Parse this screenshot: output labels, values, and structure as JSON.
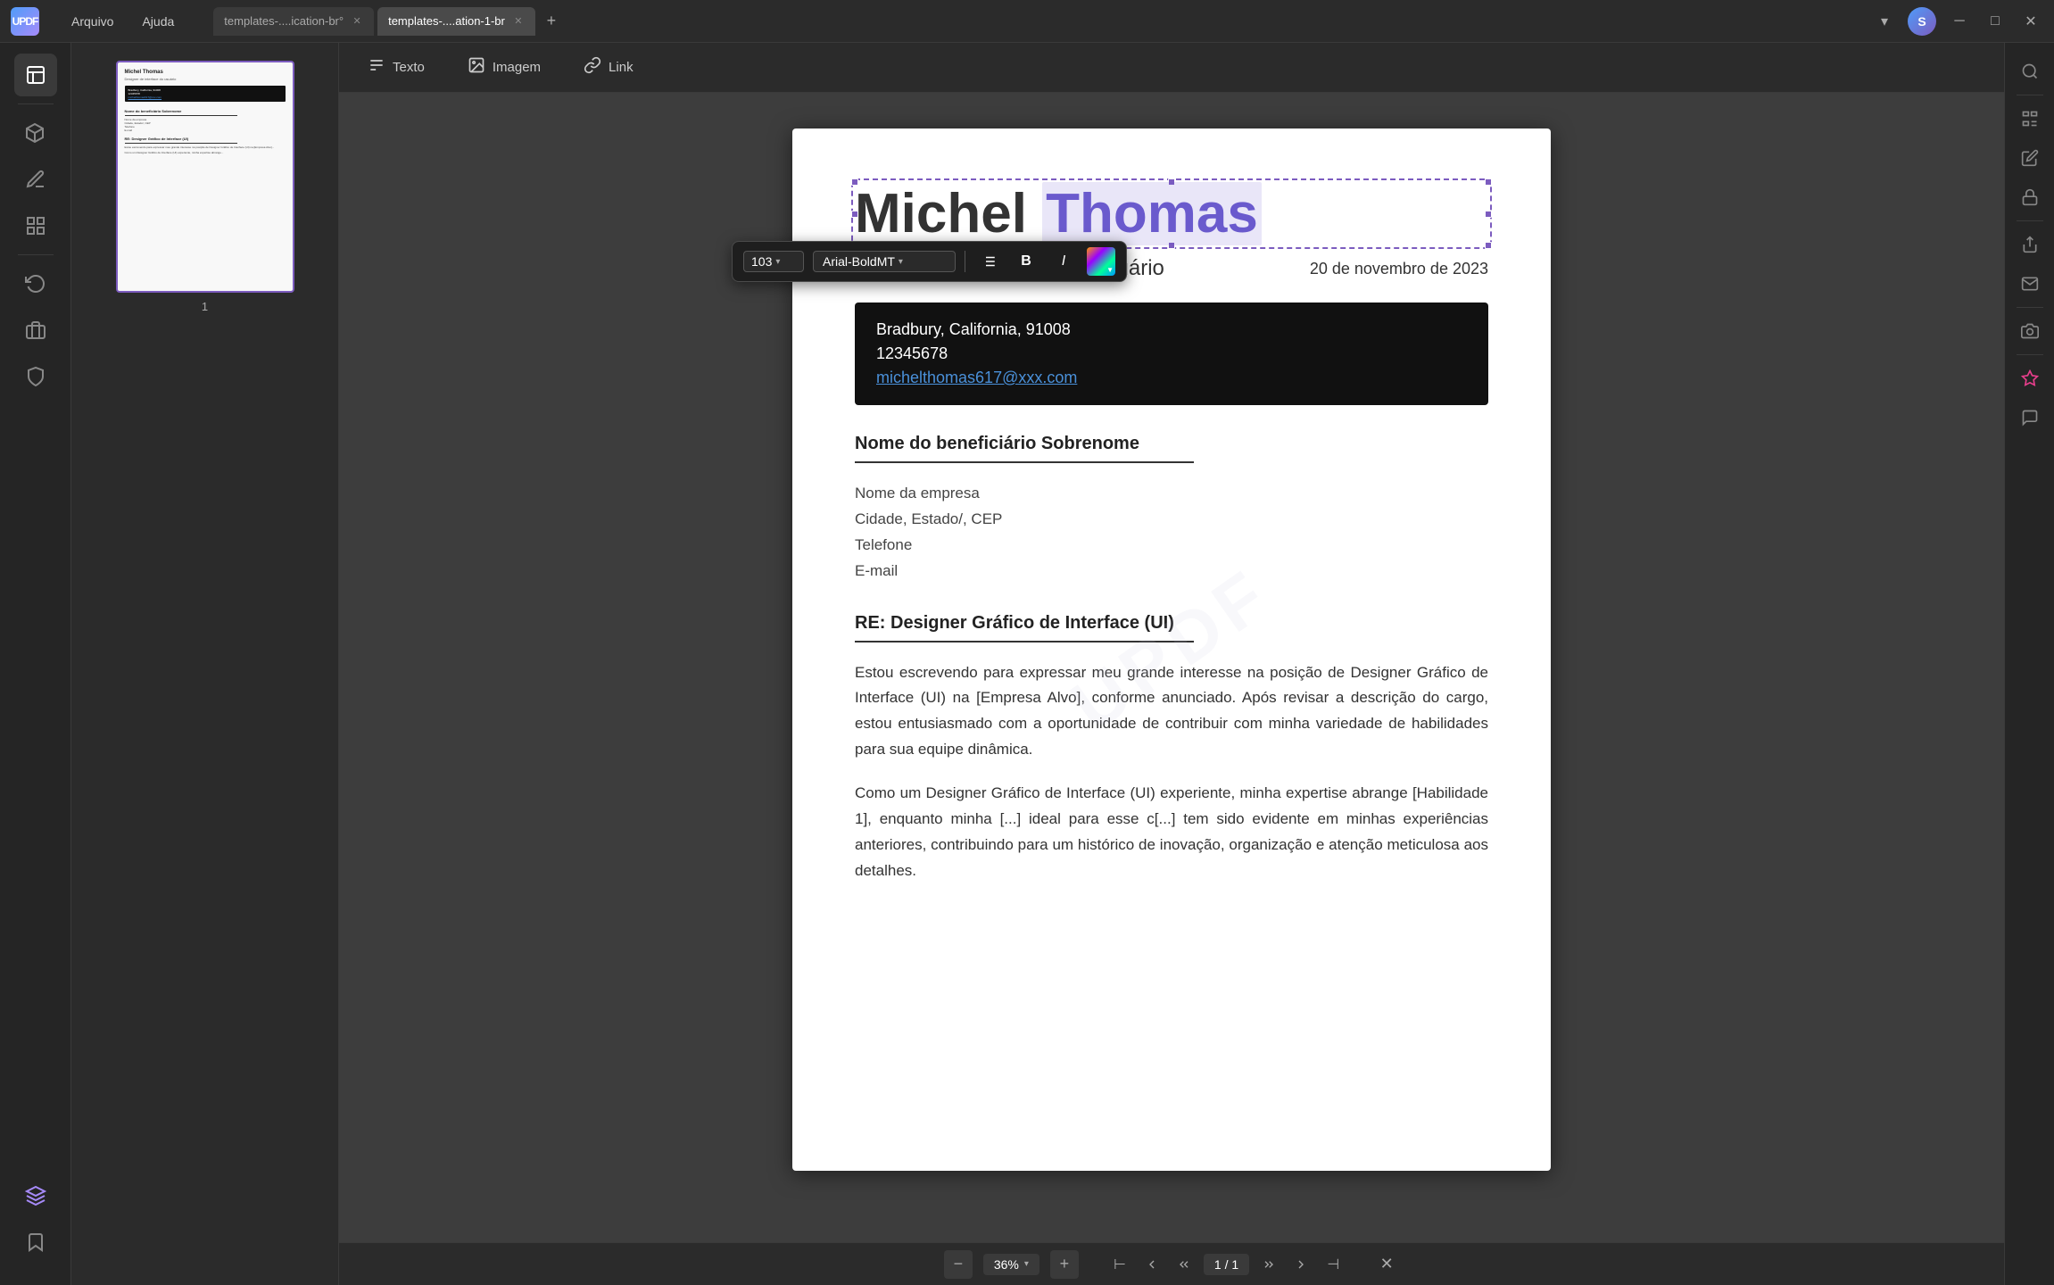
{
  "app": {
    "logo": "UPDF",
    "logo_letter": "U"
  },
  "menu": {
    "arquivo": "Arquivo",
    "ajuda": "Ajuda"
  },
  "tabs": [
    {
      "label": "templates-....ication-br°",
      "active": false
    },
    {
      "label": "templates-....ation-1-br",
      "active": true
    }
  ],
  "user_avatar": "S",
  "toolbar": {
    "texto": "Texto",
    "imagem": "Imagem",
    "link": "Link"
  },
  "formatting": {
    "font_size": "103",
    "font_name": "Arial-BoldMT",
    "align_icon": "≡",
    "bold": "B",
    "italic": "I"
  },
  "document": {
    "name_first": "Michel",
    "name_last": "Thomas",
    "subtitle": "Designer de interface do usuário",
    "date": "20 de novembro de 2023",
    "contact": {
      "city": "Bradbury, California, 91008",
      "phone": "12345678",
      "email": "michelthomas617@xxx.com"
    },
    "recipient_section": {
      "title": "Nome do beneficiário Sobrenome",
      "company": "Nome da empresa",
      "address": "Cidade, Estado/, CEP",
      "phone": "Telefone",
      "email": "E-mail"
    },
    "re_section": {
      "title": "RE: Designer Gráfico de Interface (UI)",
      "paragraph1": "Estou escrevendo para expressar meu grande interesse na posição de Designer Gráfico de Interface (UI) na [Empresa Alvo], conforme anunciado. Após revisar a descrição do cargo, estou entusiasmado com a oportunidade de contribuir com minha variedade de habilidades para sua equipe dinâmica.",
      "paragraph2": "Como um Designer Gráfico de Interface (UI) experiente, minha expertise abrange [Habilidade 1], enquanto minha [...] ideal para esse c[...] tem sido evidente em minhas experiências anteriores, contribuindo para um histórico de inovação, organização e atenção meticulosa aos detalhes."
    }
  },
  "bottom_bar": {
    "zoom_minus": "−",
    "zoom_value": "36%",
    "zoom_plus": "+",
    "page_current": "1",
    "page_total": "1",
    "page_display": "1 / 1"
  },
  "thumbnail": {
    "page_number": "1"
  },
  "sidebar": {
    "icons": [
      "📖",
      "✏️",
      "📋",
      "📊",
      "🔍",
      "🖼️",
      "📚",
      "⭐"
    ]
  }
}
